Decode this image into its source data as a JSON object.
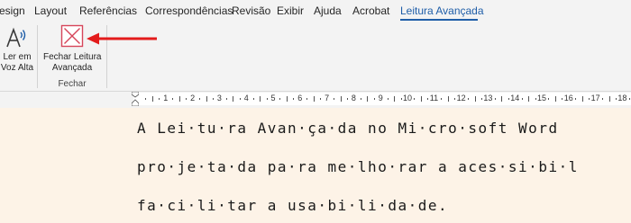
{
  "tabs": [
    "esign",
    "Layout",
    "Referências",
    "Correspondências",
    "Revisão",
    "Exibir",
    "Ajuda",
    "Acrobat",
    "Leitura Avançada"
  ],
  "active_tab": "Leitura Avançada",
  "ribbon": {
    "read_aloud": {
      "line1": "Ler em",
      "line2": "Voz Alta"
    },
    "close_reader": {
      "line1": "Fechar Leitura",
      "line2": "Avançada"
    },
    "group_label": "Fechar"
  },
  "ruler": {
    "numbers": [
      "1",
      "2",
      "3",
      "4",
      "5",
      "6",
      "7",
      "8",
      "9",
      "10",
      "11",
      "12",
      "13",
      "14",
      "15",
      "16",
      "17",
      "18"
    ]
  },
  "document": {
    "lines": [
      "A Lei·tu·ra Avan·ça·da no Mi·cro·soft Word",
      "pro·je·ta·da pa·ra me·lho·rar a aces·si·bi·l",
      "fa·ci·li·tar a usa·bi·li·da·de."
    ]
  },
  "colors": {
    "accent": "#1f5ea8",
    "arrow": "#e31b1b",
    "doc_bg": "#fdf3e7",
    "ribbon_bg": "#f3f3f3"
  }
}
